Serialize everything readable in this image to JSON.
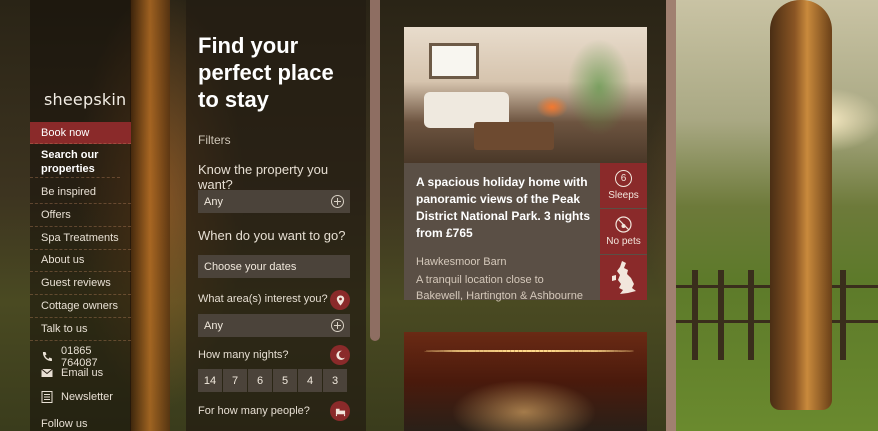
{
  "brand": {
    "logo_text": "sheepskin"
  },
  "nav": {
    "items": [
      {
        "label": "Book now"
      },
      {
        "label": "Search our properties"
      },
      {
        "label": "Be inspired"
      },
      {
        "label": "Offers"
      },
      {
        "label": "Spa Treatments"
      },
      {
        "label": "About us"
      },
      {
        "label": "Guest reviews"
      },
      {
        "label": "Cottage owners"
      },
      {
        "label": "Talk to us"
      }
    ],
    "phone": "01865 764087",
    "email": "Email us",
    "newsletter": "Newsletter",
    "follow": "Follow us"
  },
  "filters": {
    "title": "Find your perfect place to stay",
    "heading": "Filters",
    "property_label": "Know the property you want?",
    "property_value": "Any",
    "when_label": "When do you want to go?",
    "dates_value": "Choose your dates",
    "area_label": "What area(s) interest you?",
    "area_value": "Any",
    "nights_label": "How many nights?",
    "nights_options": [
      "14",
      "7",
      "6",
      "5",
      "4",
      "3"
    ],
    "people_label": "For how many people?"
  },
  "property": {
    "headline": "A spacious holiday home with panoramic views of the Peak District National Park. 3 nights from £765",
    "name": "Hawkesmoor Barn",
    "description": "A tranquil location close to Bakewell, Hartington & Ashbourne",
    "sleeps_count": "6",
    "sleeps_label": "Sleeps",
    "pets_label": "No pets"
  },
  "colors": {
    "accent": "#8a2a2a",
    "panel": "#4b433a"
  }
}
